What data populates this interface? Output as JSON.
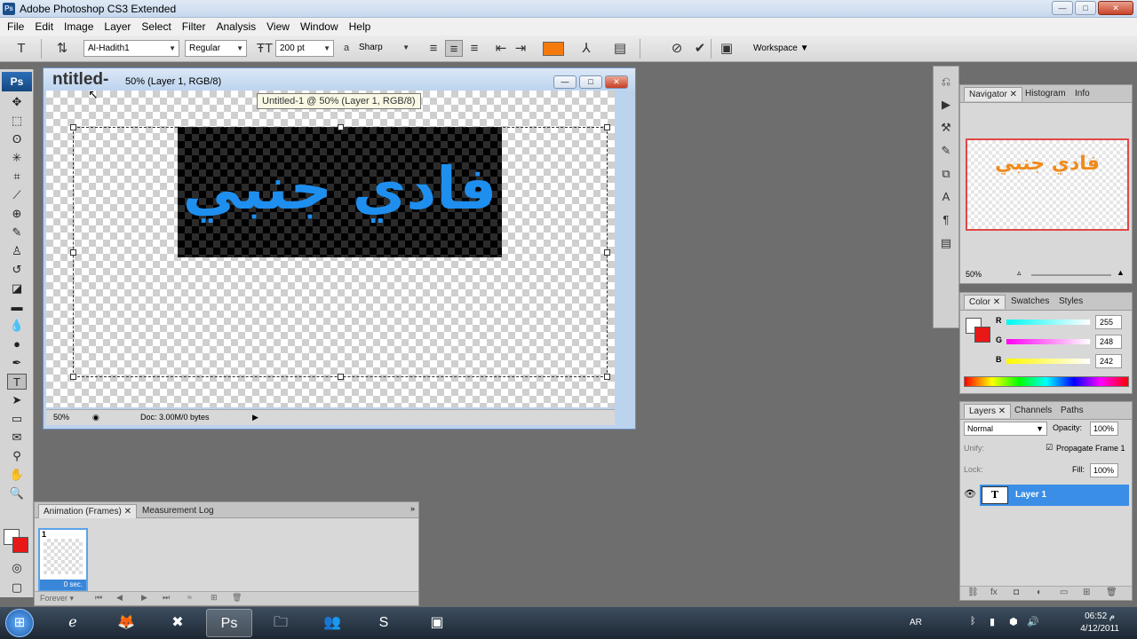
{
  "window": {
    "title": "Adobe Photoshop CS3 Extended",
    "logo": "Ps",
    "min": "—",
    "max": "□",
    "close": "✕"
  },
  "menu": [
    "File",
    "Edit",
    "Image",
    "Layer",
    "Select",
    "Filter",
    "Analysis",
    "View",
    "Window",
    "Help"
  ],
  "options": {
    "font_family": "Al-Hadith1",
    "font_style": "Regular",
    "font_size": "200 pt",
    "aa_label": "a",
    "antialias": "Sharp",
    "text_color": "#f47a0e",
    "workspace": "Workspace"
  },
  "document": {
    "title": "50% (Layer 1, RGB/8)",
    "title_drag_text": "ntitled-",
    "tooltip": "Untitled-1 @ 50% (Layer 1, RGB/8)",
    "text": "فادي جنبي",
    "text_color": "#1e8fef",
    "zoom": "50%",
    "doc_info": "Doc: 3.00M/0 bytes"
  },
  "animation": {
    "tabs": [
      "Animation (Frames)",
      "Measurement Log"
    ],
    "frame_number": "1",
    "frame_delay": "0 sec.",
    "loop": "Forever"
  },
  "navigator": {
    "tabs": [
      "Navigator",
      "Histogram",
      "Info"
    ],
    "preview_text": "فادي جنبي",
    "preview_color": "#f08a1a",
    "zoom": "50%"
  },
  "color": {
    "tabs": [
      "Color",
      "Swatches",
      "Styles"
    ],
    "r_label": "R",
    "g_label": "G",
    "b_label": "B",
    "r": "255",
    "g": "248",
    "b": "242",
    "foreground": "#ffffff",
    "background": "#e81818"
  },
  "layers": {
    "tabs": [
      "Layers",
      "Channels",
      "Paths"
    ],
    "blend_mode": "Normal",
    "opacity_label": "Opacity:",
    "opacity": "100%",
    "unify_label": "Unify:",
    "propagate_label": "Propagate Frame 1",
    "lock_label": "Lock:",
    "fill_label": "Fill:",
    "fill": "100%",
    "layer_name": "Layer 1",
    "layer_icon": "T"
  },
  "taskbar": {
    "language": "AR",
    "time": "06:52 م",
    "date": "4/12/2011"
  }
}
